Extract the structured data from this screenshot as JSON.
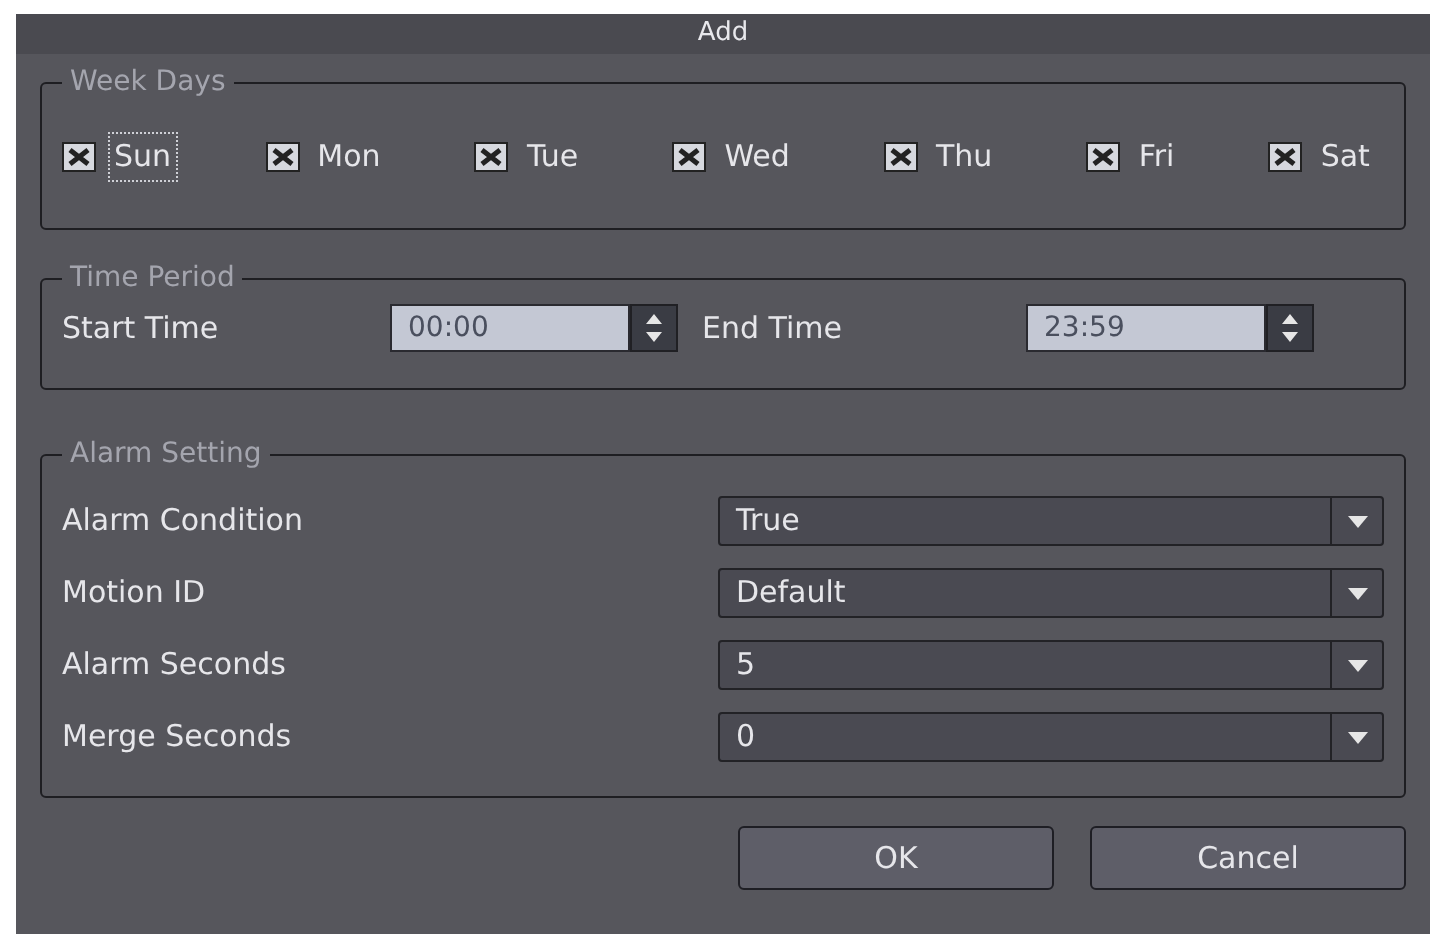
{
  "window": {
    "title": "Add"
  },
  "week_days": {
    "legend": "Week Days",
    "days": [
      {
        "label": "Sun",
        "checked": true,
        "focused": true
      },
      {
        "label": "Mon",
        "checked": true,
        "focused": false
      },
      {
        "label": "Tue",
        "checked": true,
        "focused": false
      },
      {
        "label": "Wed",
        "checked": true,
        "focused": false
      },
      {
        "label": "Thu",
        "checked": true,
        "focused": false
      },
      {
        "label": "Fri",
        "checked": true,
        "focused": false
      },
      {
        "label": "Sat",
        "checked": true,
        "focused": false
      }
    ]
  },
  "time_period": {
    "legend": "Time Period",
    "start_label": "Start Time",
    "start_value": "00:00",
    "end_label": "End Time",
    "end_value": "23:59"
  },
  "alarm_setting": {
    "legend": "Alarm Setting",
    "rows": [
      {
        "label": "Alarm Condition",
        "value": "True"
      },
      {
        "label": "Motion ID",
        "value": "Default"
      },
      {
        "label": "Alarm Seconds",
        "value": "5"
      },
      {
        "label": "Merge Seconds",
        "value": "0"
      }
    ]
  },
  "buttons": [
    "OK",
    "Cancel"
  ]
}
